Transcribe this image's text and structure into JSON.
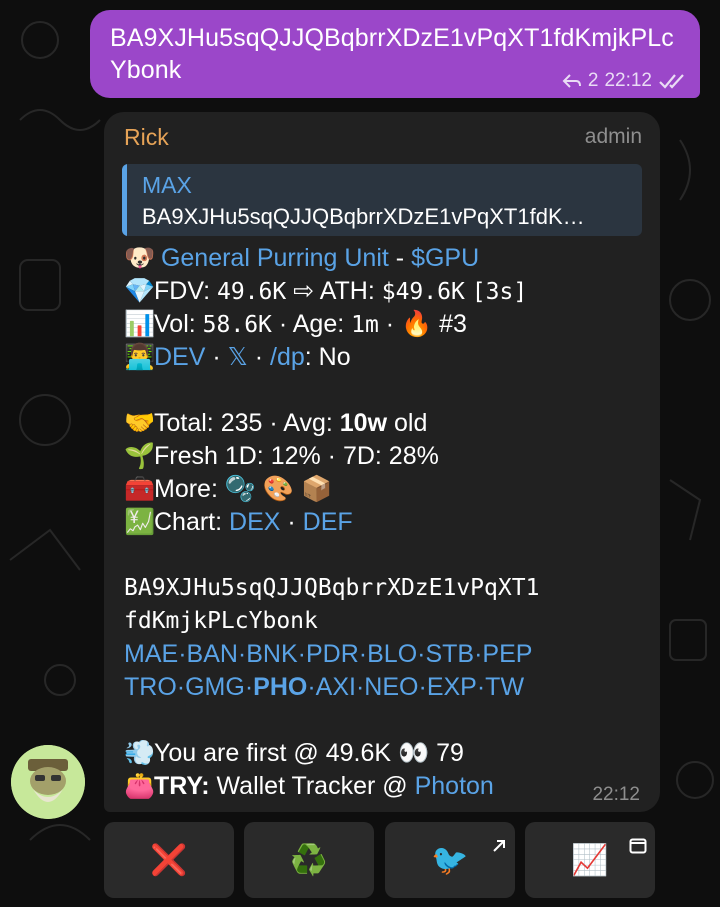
{
  "outgoing": {
    "text": "BA9XJHu5sqQJJQBqbrrXDzE1vPqXT1fdKmjkPLcYbonk",
    "reply_count": "2",
    "time": "22:12"
  },
  "incoming": {
    "sender": "Rick",
    "role": "admin",
    "reply": {
      "name": "MAX",
      "text": "BA9XJHu5sqQJJQBqbrrXDzE1vPqXT1fdK…"
    },
    "token": {
      "emoji": "🐶",
      "name": "General Purring Unit",
      "sep": " - ",
      "ticker": "$GPU"
    },
    "fdv": {
      "emoji": "💎",
      "label": "FDV: ",
      "value": "49.6K",
      "arrow": " ⇨ ",
      "ath_label": "ATH: ",
      "ath": "$49.6K",
      "ath_age": "[3s]"
    },
    "vol": {
      "emoji": "📊",
      "label": "Vol: ",
      "value": "58.6K",
      "age_label": " · Age: ",
      "age": "1m",
      "sep": " · ",
      "fire": "🔥",
      "rank": " #3"
    },
    "dev": {
      "emoji": "👨‍💻",
      "dev_link": "DEV",
      "sep1": " · ",
      "x_link": "𝕏",
      "sep2": " · ",
      "dp_link": "/dp",
      "dp_value": ": No"
    },
    "total": {
      "emoji": "🤝",
      "label": "Total: ",
      "value": "235",
      "avg_label": " · Avg: ",
      "avg": "10w",
      "avg_suffix": " old"
    },
    "fresh": {
      "emoji": "🌱",
      "text": "Fresh 1D: 12% · 7D: 28%"
    },
    "more": {
      "emoji": "🧰",
      "label": "More: ",
      "icons": "🫧 🎨 📦"
    },
    "chart": {
      "emoji": "💹",
      "label": "Chart: ",
      "dex": "DEX",
      "sep": " · ",
      "def": "DEF"
    },
    "address_line1": "BA9XJHu5sqQJJQBqbrrXDzE1vPqXT1",
    "address_line2": "fdKmjkPLcYbonk",
    "links_row1": [
      "MAE",
      "BAN",
      "BNK",
      "PDR",
      "BLO",
      "STB",
      "PEP"
    ],
    "links_row2": [
      "TRO",
      "GMG",
      "PHO",
      "AXI",
      "NEO",
      "EXP",
      "TW"
    ],
    "first": {
      "emoji": "💨",
      "text": "You are first @ 49.6K ",
      "eyes": "👀",
      "count": " 79"
    },
    "try": {
      "emoji": "👛",
      "label": "TRY:",
      "text": " Wallet Tracker @ ",
      "link": "Photon"
    },
    "time": "22:12"
  },
  "buttons": [
    {
      "name": "close",
      "glyph": "❌"
    },
    {
      "name": "recycle",
      "glyph": "♻️"
    },
    {
      "name": "bird",
      "glyph": "🐦"
    },
    {
      "name": "chart",
      "glyph": "📈"
    }
  ],
  "colors": {
    "outgoing_bubble": "#9b47c9",
    "incoming_bubble": "#212121",
    "link": "#5aa3e6",
    "sender": "#e6a357"
  }
}
